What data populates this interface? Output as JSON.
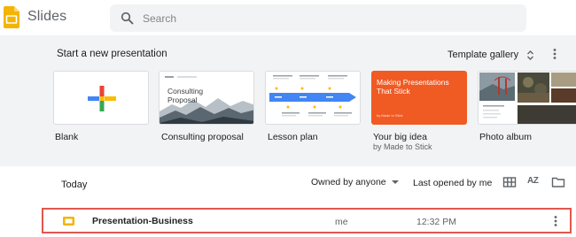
{
  "header": {
    "app_name": "Slides",
    "search": {
      "placeholder": "Search",
      "value": ""
    }
  },
  "templates": {
    "section_title": "Start a new presentation",
    "gallery_label": "Template gallery",
    "items": [
      {
        "label": "Blank",
        "subtitle": ""
      },
      {
        "label": "Consulting proposal",
        "subtitle": "",
        "thumb_title": "Consulting Proposal"
      },
      {
        "label": "Lesson plan",
        "subtitle": ""
      },
      {
        "label": "Your big idea",
        "subtitle": "by Made to Stick",
        "thumb_title": "Making Presentations That Stick"
      },
      {
        "label": "Photo album",
        "subtitle": ""
      }
    ]
  },
  "files": {
    "section_title": "Today",
    "owner_filter": "Owned by anyone",
    "sort_label": "Last opened by me",
    "sort_az_label": "AZ",
    "rows": [
      {
        "name": "Presentation-Business",
        "owner": "me",
        "time": "12:32 PM"
      }
    ]
  },
  "colors": {
    "slides_yellow": "#f4b400",
    "band_gray": "#f1f3f4",
    "highlight_red": "#e0574f",
    "orange_template": "#f05a23"
  }
}
